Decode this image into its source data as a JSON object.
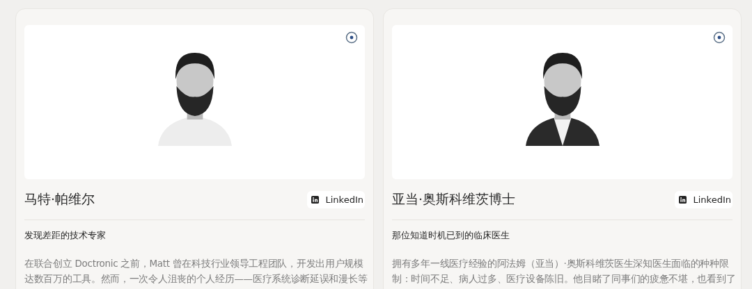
{
  "people": [
    {
      "name": "马特·帕维尔",
      "link": "LinkedIn",
      "tagline": "发现差距的技术专家",
      "bio_lines": [
        "在联合创立 Doctronic 之前，Matt 曾在科技行业领导工程团队，开发出用户规模",
        "达数百万的工具。然而，一次令人沮丧的个人经历——医疗系统诊断延误和漫长等"
      ],
      "kind": "picture",
      "suit": false
    },
    {
      "name": "亚当·奥斯科维茨博士",
      "link": "LinkedIn",
      "tagline": "那位知道时机已到的临床医生",
      "bio_lines": [
        "拥有多年一线医疗经验的阿法姆（亚当）·奥斯科维茨医生深知医生面临的种种限",
        "制：时间不足、病人过多、医疗设备陈旧。他目睹了同事们的疲惫不堪，也看到了"
      ],
      "kind": "picture",
      "suit": true
    }
  ]
}
